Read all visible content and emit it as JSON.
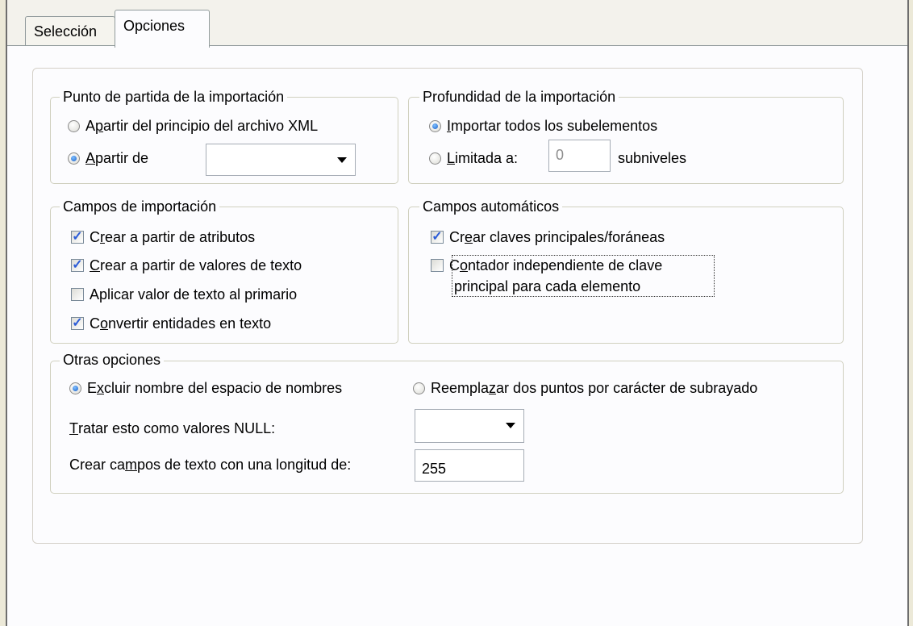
{
  "tabs": {
    "seleccion": "Selección",
    "opciones": "Opciones"
  },
  "punto_partida": {
    "legend": "Punto de partida de la importación",
    "opt1_pre": "A ",
    "opt1_u": "p",
    "opt1_post": "artir del principio del archivo XML",
    "opt2_u": "A",
    "opt2_post": " partir de",
    "combo_value": ""
  },
  "profundidad": {
    "legend": "Profundidad de la importación",
    "opt1_u": "I",
    "opt1_post": "mportar todos los subelementos",
    "opt2_u": "L",
    "opt2_post": "imitada a:",
    "limit_value": "0",
    "suffix": "subniveles"
  },
  "campos_importacion": {
    "legend": "Campos de importación",
    "c1_pre": "C",
    "c1_u": "r",
    "c1_post": "ear a partir de atributos",
    "c2_u": "C",
    "c2_post": "rear a partir de valores de texto",
    "c3": "Aplicar valor de texto al primario",
    "c4_pre": "C",
    "c4_u": "o",
    "c4_post": "nvertir entidades en texto"
  },
  "campos_automaticos": {
    "legend": "Campos automáticos",
    "c1_pre": "Cr",
    "c1_u": "e",
    "c1_post": "ar claves principales/foráneas",
    "c2_pre": "C",
    "c2_u": "o",
    "c2_post": "ntador independiente de clave",
    "c2_line2": "principal para cada elemento"
  },
  "otras": {
    "legend": "Otras opciones",
    "r1_pre": "E",
    "r1_u": "x",
    "r1_post": "cluir nombre del espacio de nombres",
    "r2_pre": "Reempla",
    "r2_u": "z",
    "r2_post": "ar dos puntos por carácter de subrayado",
    "null_u": "T",
    "null_post": "ratar esto como valores NULL:",
    "null_value": "",
    "len_pre": "Crear ca",
    "len_u": "m",
    "len_post": "pos de texto con una longitud de:",
    "len_value": "255"
  },
  "state": {
    "punto_partida_selected": "A partir de",
    "profundidad_selected": "Importar todos los subelementos",
    "otras_selected": "Excluir nombre del espacio de nombres",
    "checks": {
      "crear_atributos": true,
      "crear_valores_texto": true,
      "aplicar_primario": false,
      "convertir_entidades": true,
      "crear_claves": true,
      "contador_independiente": false
    }
  }
}
